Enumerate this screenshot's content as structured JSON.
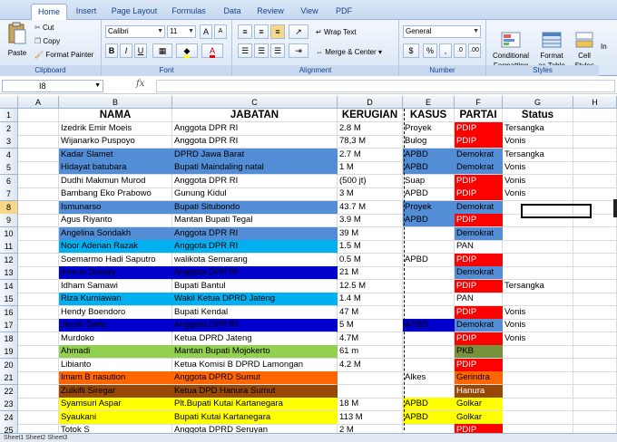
{
  "ribbon": {
    "tabs": [
      "Home",
      "Insert",
      "Page Layout",
      "Formulas",
      "Data",
      "Review",
      "View",
      "PDF"
    ],
    "active_tab": "Home",
    "clipboard": {
      "paste": "Paste",
      "cut": "Cut",
      "copy": "Copy",
      "format_painter": "Format Painter",
      "label": "Clipboard"
    },
    "font": {
      "name": "Calibri",
      "size": "11",
      "label": "Font"
    },
    "alignment": {
      "wrap_text": "Wrap Text",
      "merge_center": "Merge & Center",
      "label": "Alignment"
    },
    "number": {
      "format": "General",
      "currency": "$",
      "percent": "%",
      "comma": ",",
      "label": "Number"
    },
    "styles": {
      "conditional": "Conditional\nFormatting",
      "format_table": "Format\nas Table",
      "cell_styles": "Cell\nStyles",
      "insert": "In",
      "label": "Styles"
    }
  },
  "formula_bar": {
    "name_box": "I8",
    "fx": "fx",
    "value": ""
  },
  "columns": [
    "A",
    "B",
    "C",
    "D",
    "E",
    "F",
    "G",
    "H"
  ],
  "selected_row": 8,
  "header_row": [
    "",
    "NAMA",
    "JABATAN",
    "KERUGIAN",
    "KASUS",
    "PARTAI",
    "Status",
    ""
  ],
  "rows": [
    [
      "Izedrik Emir Moeis",
      "Anggota DPR RI",
      "2.8 M",
      "Proyek",
      "PDIP",
      "Tersangka"
    ],
    [
      "Wijanarko Puspoyo",
      "Anggota DPR RI",
      "78,3 M",
      "Bulog",
      "PDIP",
      "Vonis"
    ],
    [
      "Kadar Slamet",
      "DPRD Jawa Barat",
      "2.7 M",
      "APBD",
      "Demokrat",
      "Tersangka"
    ],
    [
      "Hidayat batubara",
      "Bupati Maindaling natal",
      "1 M",
      "APBD",
      "Demokrat",
      "Vonis"
    ],
    [
      "Dudhi Makmun Murod",
      "Anggota DPR RI",
      "(500 jt)",
      "Suap",
      "PDIP",
      "Vonis"
    ],
    [
      "Bambang Eko Prabowo",
      "Gunung Kidul",
      "3 M",
      "APBD",
      "PDIP",
      "Vonis"
    ],
    [
      "Ismunarso",
      "Bupati Situbondo",
      "43.7 M",
      "Proyek",
      "Demokrat",
      ""
    ],
    [
      "Agus Riyanto",
      "Mantan Bupati Tegal",
      "3.9 M",
      "APBD",
      "PDIP",
      ""
    ],
    [
      "Angelina Sondakh",
      "Anggota DPR RI",
      "39 M",
      "",
      "Demokrat",
      ""
    ],
    [
      "Noor Adenan Razak",
      "Anggota DPR RI",
      "1.5 M",
      "",
      "PAN",
      ""
    ],
    [
      "Soemarmo Hadi Saputro",
      "walikota Semarang",
      "0.5 M",
      "APBD",
      "PDIP",
      ""
    ],
    [
      "Amrun Daulay",
      "Anggota DPR RI",
      "21 M",
      "",
      "Demokrat",
      ""
    ],
    [
      "Idham Samawi",
      "Bupati Bantul",
      "12.5 M",
      "",
      "PDIP",
      "Tersangka"
    ],
    [
      "Riza Kurniawan",
      "Wakil Ketua DPRD Jateng",
      "1.4 M",
      "",
      "PAN",
      ""
    ],
    [
      "Hendy Boendoro",
      "Bupati Kendal",
      "47 M",
      "",
      "PDIP",
      "Vonis"
    ],
    [
      "Jacob Dafiq",
      "Anggota DPR RI",
      "5 M",
      "APBD",
      "Demokrat",
      "Vonis"
    ],
    [
      "Murdoko",
      "Ketua DPRD Jateng",
      "4.7M",
      "",
      "PDIP",
      "Vonis"
    ],
    [
      "Ahmadi",
      "Mantan Bupati Mojokerto",
      "61 m",
      "",
      "PKB",
      ""
    ],
    [
      "Libianto",
      "Ketua Komisi B DPRD Lamongan",
      "4.2 M",
      "",
      "PDIP",
      ""
    ],
    [
      "Imam B nasution",
      "Anggota DPRD Sumut",
      "",
      "Alkes",
      "Gerindra",
      ""
    ],
    [
      "Zulkifli Siregar",
      "Ketua DPD Hanura Sumut",
      "",
      "",
      "Hanura",
      ""
    ],
    [
      "Syamsuri Aspar",
      "Plt.Bupati Kutai Kartanegara",
      "18 M",
      "APBD",
      "Golkar",
      ""
    ],
    [
      "Syaukani",
      "Bupati Kutai Kartanegara",
      "113 M",
      "APBD",
      "Golkar",
      ""
    ],
    [
      "Totok S",
      "Anggota DPRD Seruyan",
      "2 M",
      "",
      "PDIP",
      ""
    ]
  ],
  "row_colors": {
    "bc": [
      "",
      "",
      "#538dd5",
      "#538dd5",
      "",
      "",
      "#538dd5",
      "",
      "#538dd5",
      "#00b0f0",
      "",
      "#0000cc",
      "",
      "#00b0f0",
      "",
      "#0000cc",
      "",
      "#92d050",
      "",
      "#ff6600",
      "#974706",
      "#ffff00",
      "#ffff00",
      ""
    ],
    "e": [
      "",
      "",
      "#538dd5",
      "#538dd5",
      "",
      "",
      "#538dd5",
      "#538dd5",
      "",
      "",
      "",
      "",
      "",
      "",
      "",
      "#0000cc",
      "",
      "",
      "",
      "",
      "",
      "#ffff00",
      "#ffff00",
      ""
    ],
    "f": [
      "#ff0000",
      "#ff0000",
      "#538dd5",
      "#538dd5",
      "#ff0000",
      "#ff0000",
      "#538dd5",
      "#ff0000",
      "#538dd5",
      "",
      "#ff0000",
      "#538dd5",
      "#ff0000",
      "",
      "#ff0000",
      "#538dd5",
      "#ff0000",
      "#76923c",
      "#ff0000",
      "#ff6600",
      "#974706",
      "#ffff00",
      "#ffff00",
      "#ff0000"
    ]
  },
  "sheet_tabs": "Sheet1  Sheet2  Sheet3"
}
